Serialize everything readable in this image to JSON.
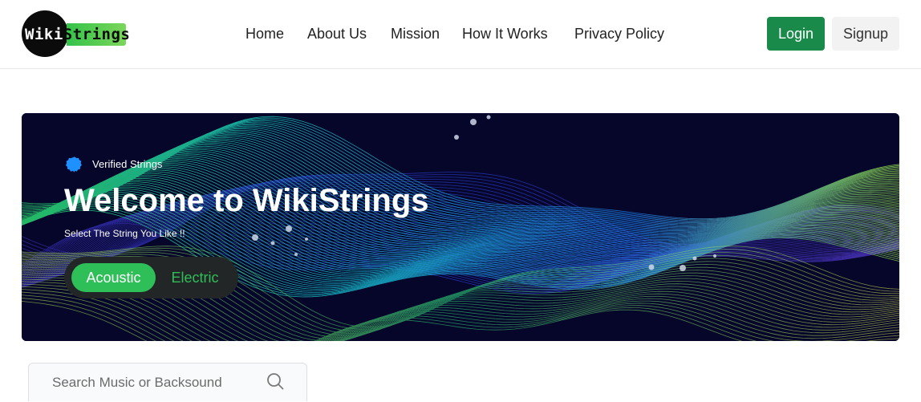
{
  "logo": {
    "text_white": "Wiki",
    "text_dark": "Strings"
  },
  "nav": {
    "links": [
      {
        "label": "Home"
      },
      {
        "label": "About Us"
      },
      {
        "label": "Mission"
      },
      {
        "label": "How It Works"
      },
      {
        "label": "Privacy Policy"
      }
    ],
    "login_label": "Login",
    "signup_label": "Signup"
  },
  "hero": {
    "badge_icon": "verified-badge-icon",
    "badge_text": "Verified Strings",
    "title": "Welcome to WikiStrings",
    "subtitle": "Select The String You Like !!",
    "toggle": {
      "active": "Acoustic",
      "inactive": "Electric"
    }
  },
  "search": {
    "placeholder": "Search Music or Backsound",
    "icon": "search-icon"
  },
  "colors": {
    "accent_green": "#1a8a4a",
    "toggle_green": "#2fbf58",
    "hero_bg": "#07072a",
    "badge_blue": "#1e90ff"
  }
}
